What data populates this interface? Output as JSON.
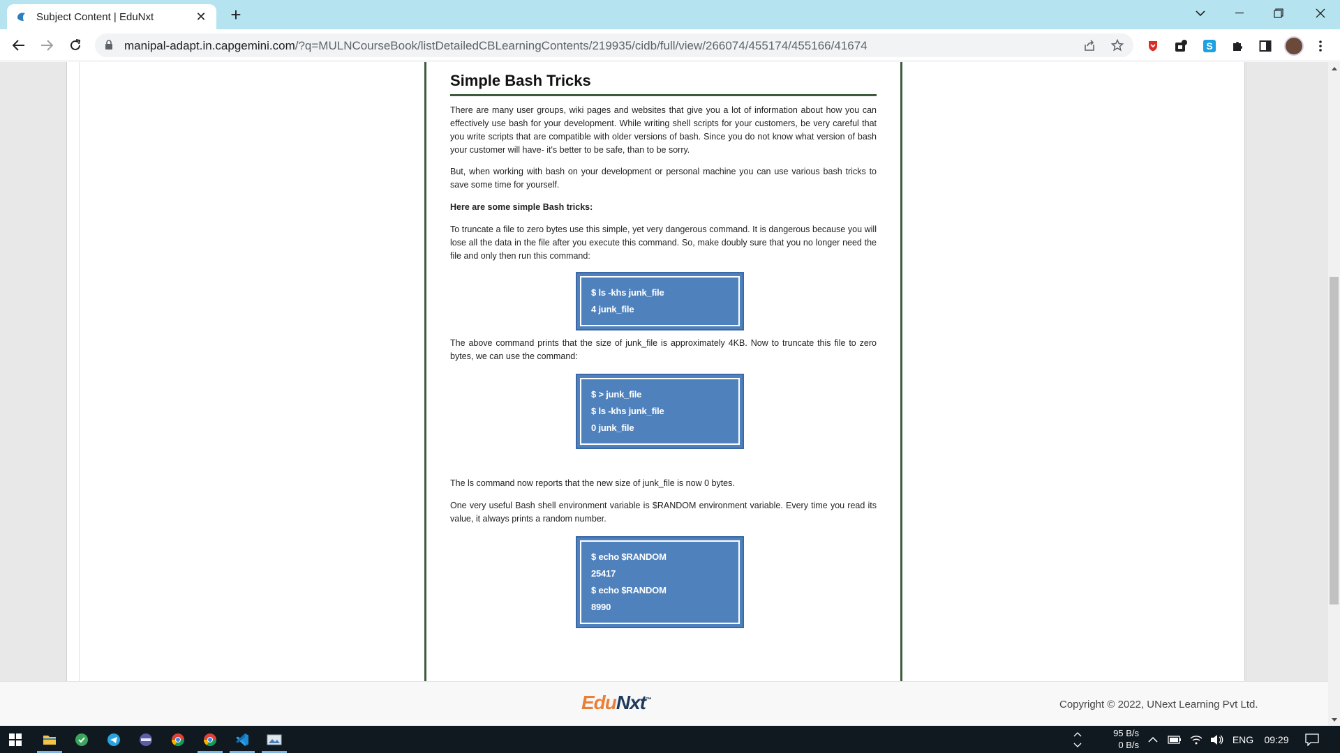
{
  "browser": {
    "tab_title": "Subject Content | EduNxt",
    "url_host": "manipal-adapt.in.capgemini.com",
    "url_path": "/?q=MULNCourseBook/listDetailedCBLearningContents/219935/cidb/full/view/266074/455174/455166/41674"
  },
  "document": {
    "heading": "Simple Bash Tricks",
    "paragraphs": [
      "There are many user groups, wiki pages and websites that give you a lot of information about how you can effectively use bash for your development. While writing shell scripts for your customers, be very careful that you write scripts that are compatible with older versions of bash. Since you do not know what version of bash your customer will have- it's better to be safe, than to be sorry.",
      "But, when working with bash on your development or personal machine you can use various bash tricks to save some time for yourself.",
      "Here are some simple Bash tricks:",
      "To truncate a file to zero bytes use this simple, yet very dangerous command. It is dangerous because you will lose all the data in the file after you execute this command. So, make doubly sure that you no longer need the file and only then run this command:",
      "The above command prints that the size of junk_file is approximately 4KB. Now to truncate this file to zero bytes, we can use the command:",
      "The ls command now reports that the new size of junk_file is now 0 bytes.",
      "One very useful Bash shell environment variable is $RANDOM environment variable. Every time you read its value, it always prints a random number."
    ],
    "code_blocks": [
      [
        "$ ls -khs junk_file",
        "4 junk_file"
      ],
      [
        "$ > junk_file",
        "$ ls -khs junk_file",
        "0 junk_file"
      ],
      [
        "$ echo $RANDOM",
        "25417",
        "$ echo $RANDOM",
        "8990"
      ]
    ]
  },
  "footer": {
    "logo_part1": "Edu",
    "logo_part2": "Nxt",
    "logo_tm": "™",
    "copyright": "Copyright © 2022, UNext Learning Pvt Ltd."
  },
  "taskbar": {
    "net_up": "95 B/s",
    "net_down": "0 B/s",
    "language": "ENG",
    "time": "09:29"
  },
  "colors": {
    "titlebar": "#b5e4f0",
    "code_bg": "#4f81bd",
    "doc_border": "#3c5a3c",
    "logo_orange": "#e8803a",
    "logo_navy": "#1f3a5f"
  }
}
